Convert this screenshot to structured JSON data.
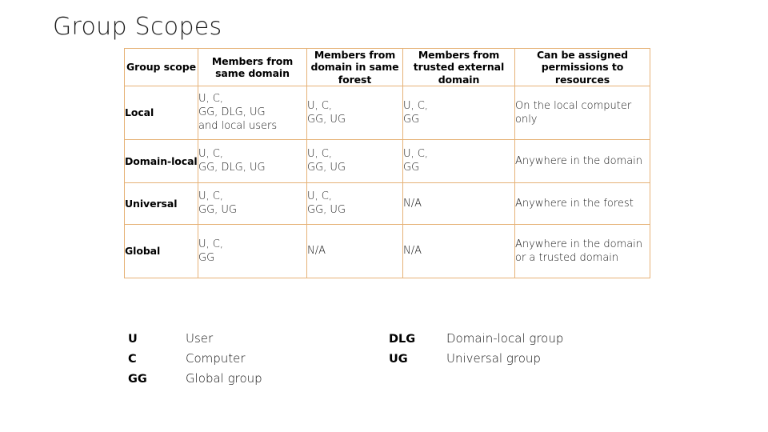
{
  "slide": {
    "title": "Group Scopes"
  },
  "table": {
    "headers": [
      "Group scope",
      "Members from same domain",
      "Members from domain in same forest",
      "Members from trusted external domain",
      "Can be assigned permissions to resources"
    ],
    "rows": [
      {
        "scope": "Local",
        "same_domain": "U, C,\nGG, DLG, UG\nand local users",
        "same_forest": "U, C,\nGG, UG",
        "external": "U, C,\nGG",
        "assigned": "On the local computer only"
      },
      {
        "scope": "Domain-local",
        "same_domain": "U, C,\nGG, DLG, UG",
        "same_forest": "U, C,\nGG, UG",
        "external": "U, C,\nGG",
        "assigned": "Anywhere in the domain"
      },
      {
        "scope": "Universal",
        "same_domain": "U, C,\nGG, UG",
        "same_forest": "U, C,\nGG, UG",
        "external": "N/A",
        "assigned": "Anywhere in the forest"
      },
      {
        "scope": "Global",
        "same_domain": "U, C,\nGG",
        "same_forest": "N/A",
        "external": "N/A",
        "assigned": "Anywhere in the domain or a trusted domain"
      }
    ]
  },
  "legend": {
    "left": [
      {
        "abbr": "U",
        "term": "User"
      },
      {
        "abbr": "C",
        "term": "Computer"
      },
      {
        "abbr": "GG",
        "term": "Global group"
      }
    ],
    "right": [
      {
        "abbr": "DLG",
        "term": "Domain-local group"
      },
      {
        "abbr": "UG",
        "term": "Universal group"
      }
    ]
  },
  "colors": {
    "table_border": "#e6b277",
    "title_text": "#1b1b1b",
    "body_text": "#171717",
    "background": "#ffffff"
  }
}
